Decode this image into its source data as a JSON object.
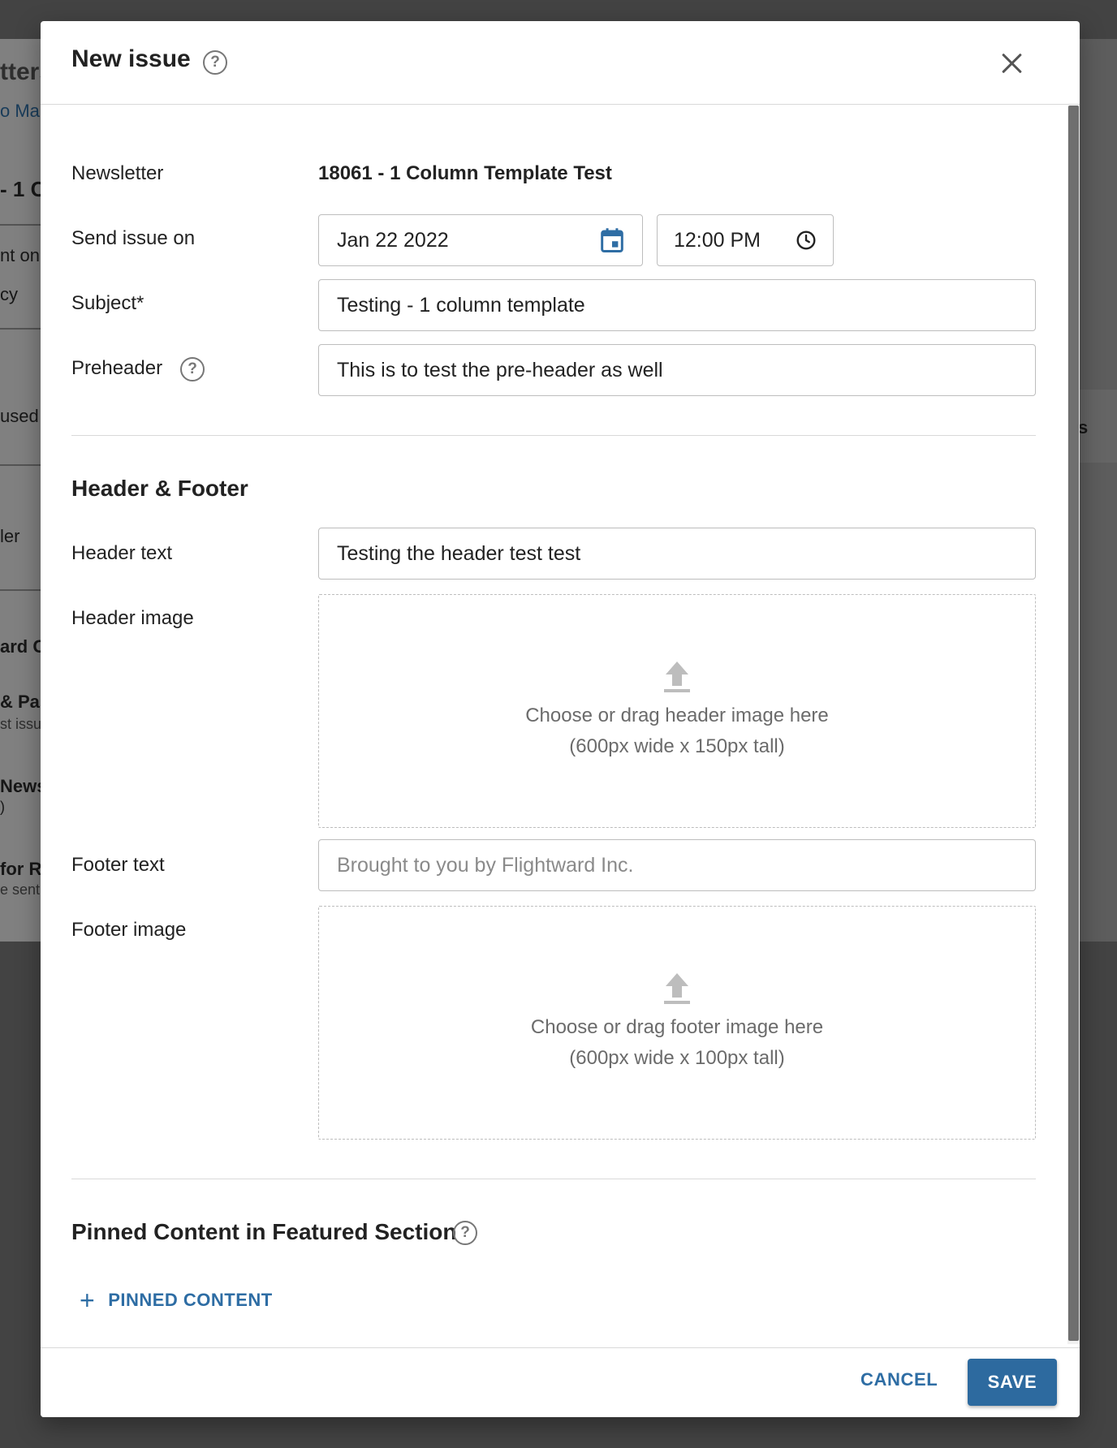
{
  "background": {
    "title_fragment": "tters",
    "link_fragment": "o Mar",
    "items": [
      "- 1 C",
      "nt on",
      "cy",
      "used",
      "ler",
      "ard C",
      "& Past",
      "st issu",
      "News",
      ")",
      "for R",
      "e sent"
    ],
    "right_fragment": "s"
  },
  "dialog": {
    "title": "New issue",
    "help_glyph": "?"
  },
  "form": {
    "newsletter_label": "Newsletter",
    "newsletter_value": "18061 - 1 Column Template Test",
    "send_label": "Send issue on",
    "send_date": "Jan 22 2022",
    "send_time": "12:00 PM",
    "subject_label": "Subject*",
    "subject_value": "Testing - 1 column template",
    "preheader_label": "Preheader",
    "preheader_value": "This is to test the pre-header as well"
  },
  "header_footer": {
    "section_title": "Header & Footer",
    "header_text_label": "Header text",
    "header_text_value": "Testing the header test test",
    "header_image_label": "Header image",
    "header_drop_line1": "Choose or drag header image here",
    "header_drop_line2": "(600px wide x 150px tall)",
    "footer_text_label": "Footer text",
    "footer_text_placeholder": "Brought to you by Flightward Inc.",
    "footer_image_label": "Footer image",
    "footer_drop_line1": "Choose or drag footer image here",
    "footer_drop_line2": "(600px wide x 100px tall)"
  },
  "pinned": {
    "section_title": "Pinned Content in Featured Section",
    "add_label": "PINNED CONTENT"
  },
  "footer": {
    "cancel_label": "CANCEL",
    "save_label": "SAVE"
  },
  "colors": {
    "accent": "#2e6da4",
    "save_bg": "#2d6a9f"
  }
}
